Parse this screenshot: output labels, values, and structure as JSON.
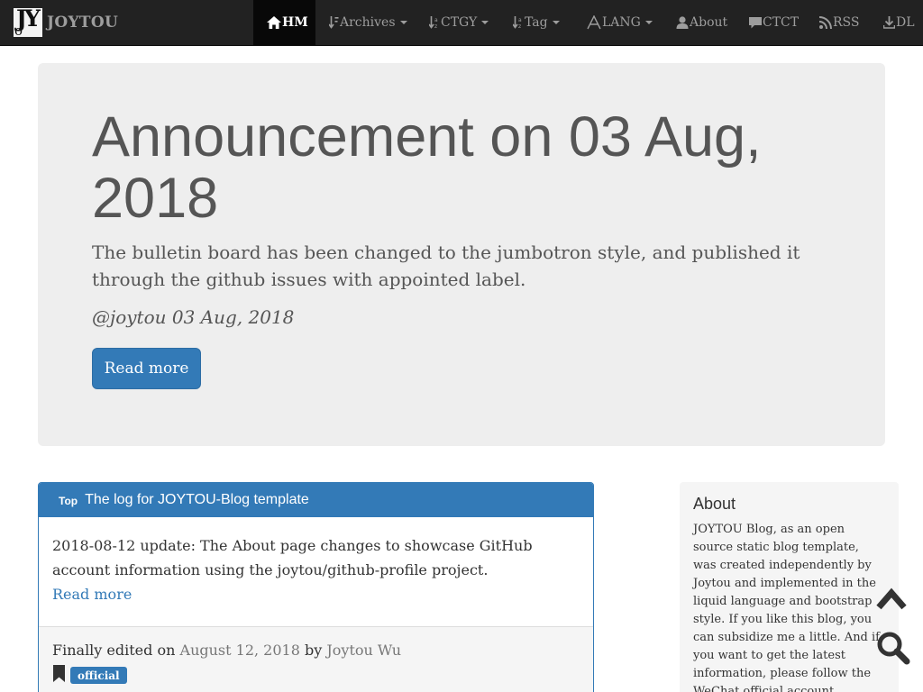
{
  "navbar": {
    "brand_name": "JOYTOU",
    "items": [
      {
        "label": "HM"
      },
      {
        "label": "Archives"
      },
      {
        "label": "CTGY"
      },
      {
        "label": "Tag"
      },
      {
        "label": "LANG"
      },
      {
        "label": "About"
      },
      {
        "label": "CTCT"
      },
      {
        "label": "RSS"
      },
      {
        "label": "DL"
      }
    ]
  },
  "jumbotron": {
    "title": "Announcement on 03 Aug, 2018",
    "text": "The bulletin board has been changed to the jumbotron style, and published it through the github issues with appointed label.",
    "meta": "@joytou 03 Aug, 2018",
    "button_label": "Read more"
  },
  "post": {
    "badge": "Top",
    "title": "The log for JOYTOU-Blog template",
    "excerpt": "2018-08-12 update: The About page changes to showcase GitHub account information using the joytou/github-profile project.",
    "read_more": "Read more",
    "edited_prefix": "Finally edited on",
    "date": "August 12, 2018",
    "by": "by",
    "author": "Joytou Wu",
    "tag": "official"
  },
  "sidebar": {
    "title": "About",
    "text": "JOYTOU Blog, as an open source static blog template, was created independently by Joytou and implemented in the liquid language and bootstrap style. If you like this blog, you can subsidize me a little. And if you want to get the latest information, please follow the WeChat official account. Wechat ID:joytouBlog"
  },
  "colors": {
    "navbar_bg": "#222222",
    "primary": "#337ab7",
    "jumbotron_bg": "#eeeeee"
  }
}
